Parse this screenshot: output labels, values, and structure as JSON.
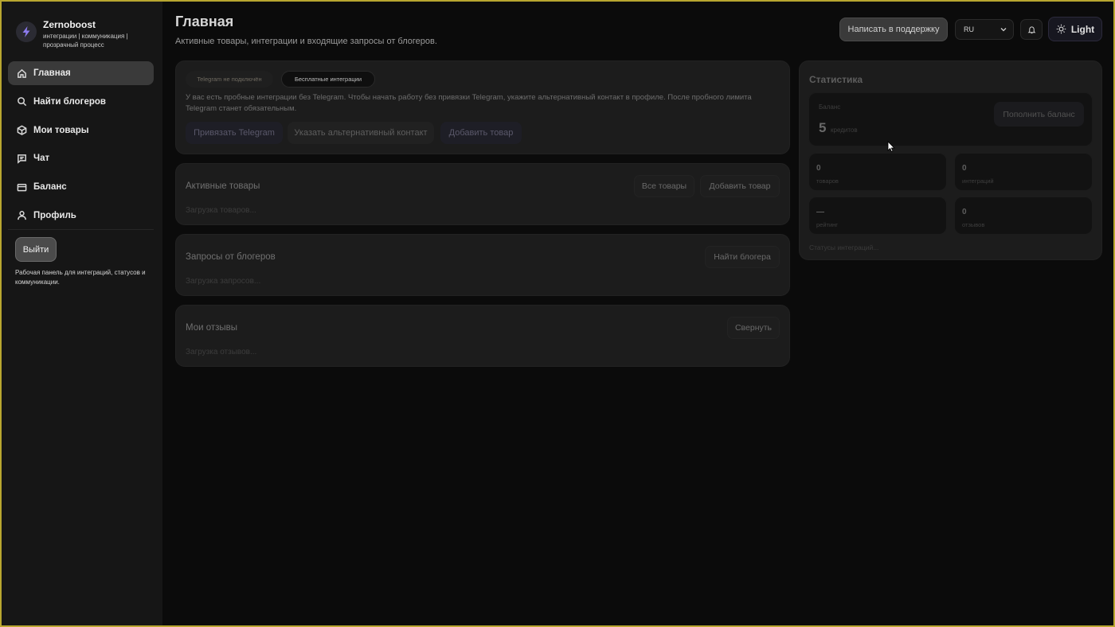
{
  "sidebar": {
    "brand_name": "Zernoboost",
    "brand_tagline": "интеграции | коммуникация | прозрачный процесс",
    "items": [
      {
        "label": "Главная",
        "icon": "home-icon",
        "active": true
      },
      {
        "label": "Найти блогеров",
        "icon": "search-icon",
        "active": false
      },
      {
        "label": "Мои товары",
        "icon": "box-icon",
        "active": false
      },
      {
        "label": "Чат",
        "icon": "chat-icon",
        "active": false
      },
      {
        "label": "Баланс",
        "icon": "wallet-icon",
        "active": false
      },
      {
        "label": "Профиль",
        "icon": "user-icon",
        "active": false
      }
    ],
    "logout_label": "Выйти",
    "note": "Рабочая панель для интеграций, статусов и коммуникации."
  },
  "header": {
    "title": "Главная",
    "subtitle": "Активные товары, интеграции и входящие запросы от блогеров.",
    "support_label": "Написать в поддержку",
    "language": "RU",
    "theme_label": "Light"
  },
  "banner": {
    "pill_telegram": "Telegram не подключён",
    "pill_free": "Бесплатные интеграции",
    "text": "У вас есть пробные интеграции без Telegram. Чтобы начать работу без привязки Telegram, укажите альтернативный контакт в профиле. После пробного лимита Telegram станет обязательным.",
    "btn_telegram": "Привязать Telegram",
    "btn_alt": "Указать альтернативный контакт",
    "btn_add": "Добавить товар"
  },
  "active_products": {
    "title": "Активные товары",
    "loading": "Загрузка товаров...",
    "btn_all": "Все товары",
    "btn_add": "Добавить товар"
  },
  "requests": {
    "title": "Запросы от блогеров",
    "loading": "Загрузка запросов...",
    "btn_find": "Найти блогера"
  },
  "reviews": {
    "title": "Мои отзывы",
    "loading": "Загрузка отзывов...",
    "btn_collapse": "Свернуть"
  },
  "stats": {
    "title": "Статистика",
    "balance_label": "Баланс",
    "balance_value": "5",
    "balance_unit": "кредитов",
    "topup_label": "Пополнить баланс",
    "tiles": [
      {
        "value": "0",
        "label": "товаров"
      },
      {
        "value": "0",
        "label": "интеграций"
      },
      {
        "value": "—",
        "label": "рейтинг"
      },
      {
        "value": "0",
        "label": "отзывов"
      }
    ],
    "footer": "Статусы интеграций..."
  }
}
